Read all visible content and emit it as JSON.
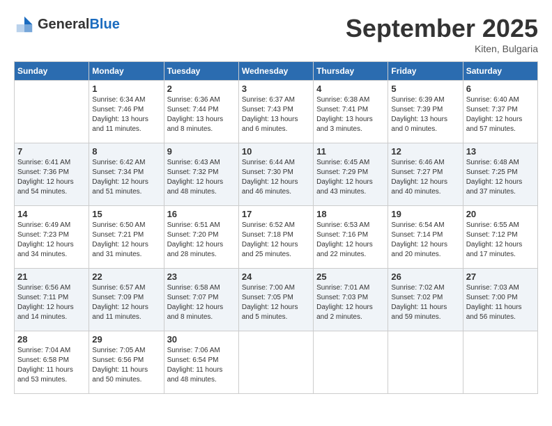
{
  "header": {
    "logo_general": "General",
    "logo_blue": "Blue",
    "month_title": "September 2025",
    "location": "Kiten, Bulgaria"
  },
  "weekdays": [
    "Sunday",
    "Monday",
    "Tuesday",
    "Wednesday",
    "Thursday",
    "Friday",
    "Saturday"
  ],
  "weeks": [
    [
      {
        "day": null
      },
      {
        "day": "1",
        "sunrise": "Sunrise: 6:34 AM",
        "sunset": "Sunset: 7:46 PM",
        "daylight": "Daylight: 13 hours and 11 minutes."
      },
      {
        "day": "2",
        "sunrise": "Sunrise: 6:36 AM",
        "sunset": "Sunset: 7:44 PM",
        "daylight": "Daylight: 13 hours and 8 minutes."
      },
      {
        "day": "3",
        "sunrise": "Sunrise: 6:37 AM",
        "sunset": "Sunset: 7:43 PM",
        "daylight": "Daylight: 13 hours and 6 minutes."
      },
      {
        "day": "4",
        "sunrise": "Sunrise: 6:38 AM",
        "sunset": "Sunset: 7:41 PM",
        "daylight": "Daylight: 13 hours and 3 minutes."
      },
      {
        "day": "5",
        "sunrise": "Sunrise: 6:39 AM",
        "sunset": "Sunset: 7:39 PM",
        "daylight": "Daylight: 13 hours and 0 minutes."
      },
      {
        "day": "6",
        "sunrise": "Sunrise: 6:40 AM",
        "sunset": "Sunset: 7:37 PM",
        "daylight": "Daylight: 12 hours and 57 minutes."
      }
    ],
    [
      {
        "day": "7",
        "sunrise": "Sunrise: 6:41 AM",
        "sunset": "Sunset: 7:36 PM",
        "daylight": "Daylight: 12 hours and 54 minutes."
      },
      {
        "day": "8",
        "sunrise": "Sunrise: 6:42 AM",
        "sunset": "Sunset: 7:34 PM",
        "daylight": "Daylight: 12 hours and 51 minutes."
      },
      {
        "day": "9",
        "sunrise": "Sunrise: 6:43 AM",
        "sunset": "Sunset: 7:32 PM",
        "daylight": "Daylight: 12 hours and 48 minutes."
      },
      {
        "day": "10",
        "sunrise": "Sunrise: 6:44 AM",
        "sunset": "Sunset: 7:30 PM",
        "daylight": "Daylight: 12 hours and 46 minutes."
      },
      {
        "day": "11",
        "sunrise": "Sunrise: 6:45 AM",
        "sunset": "Sunset: 7:29 PM",
        "daylight": "Daylight: 12 hours and 43 minutes."
      },
      {
        "day": "12",
        "sunrise": "Sunrise: 6:46 AM",
        "sunset": "Sunset: 7:27 PM",
        "daylight": "Daylight: 12 hours and 40 minutes."
      },
      {
        "day": "13",
        "sunrise": "Sunrise: 6:48 AM",
        "sunset": "Sunset: 7:25 PM",
        "daylight": "Daylight: 12 hours and 37 minutes."
      }
    ],
    [
      {
        "day": "14",
        "sunrise": "Sunrise: 6:49 AM",
        "sunset": "Sunset: 7:23 PM",
        "daylight": "Daylight: 12 hours and 34 minutes."
      },
      {
        "day": "15",
        "sunrise": "Sunrise: 6:50 AM",
        "sunset": "Sunset: 7:21 PM",
        "daylight": "Daylight: 12 hours and 31 minutes."
      },
      {
        "day": "16",
        "sunrise": "Sunrise: 6:51 AM",
        "sunset": "Sunset: 7:20 PM",
        "daylight": "Daylight: 12 hours and 28 minutes."
      },
      {
        "day": "17",
        "sunrise": "Sunrise: 6:52 AM",
        "sunset": "Sunset: 7:18 PM",
        "daylight": "Daylight: 12 hours and 25 minutes."
      },
      {
        "day": "18",
        "sunrise": "Sunrise: 6:53 AM",
        "sunset": "Sunset: 7:16 PM",
        "daylight": "Daylight: 12 hours and 22 minutes."
      },
      {
        "day": "19",
        "sunrise": "Sunrise: 6:54 AM",
        "sunset": "Sunset: 7:14 PM",
        "daylight": "Daylight: 12 hours and 20 minutes."
      },
      {
        "day": "20",
        "sunrise": "Sunrise: 6:55 AM",
        "sunset": "Sunset: 7:12 PM",
        "daylight": "Daylight: 12 hours and 17 minutes."
      }
    ],
    [
      {
        "day": "21",
        "sunrise": "Sunrise: 6:56 AM",
        "sunset": "Sunset: 7:11 PM",
        "daylight": "Daylight: 12 hours and 14 minutes."
      },
      {
        "day": "22",
        "sunrise": "Sunrise: 6:57 AM",
        "sunset": "Sunset: 7:09 PM",
        "daylight": "Daylight: 12 hours and 11 minutes."
      },
      {
        "day": "23",
        "sunrise": "Sunrise: 6:58 AM",
        "sunset": "Sunset: 7:07 PM",
        "daylight": "Daylight: 12 hours and 8 minutes."
      },
      {
        "day": "24",
        "sunrise": "Sunrise: 7:00 AM",
        "sunset": "Sunset: 7:05 PM",
        "daylight": "Daylight: 12 hours and 5 minutes."
      },
      {
        "day": "25",
        "sunrise": "Sunrise: 7:01 AM",
        "sunset": "Sunset: 7:03 PM",
        "daylight": "Daylight: 12 hours and 2 minutes."
      },
      {
        "day": "26",
        "sunrise": "Sunrise: 7:02 AM",
        "sunset": "Sunset: 7:02 PM",
        "daylight": "Daylight: 11 hours and 59 minutes."
      },
      {
        "day": "27",
        "sunrise": "Sunrise: 7:03 AM",
        "sunset": "Sunset: 7:00 PM",
        "daylight": "Daylight: 11 hours and 56 minutes."
      }
    ],
    [
      {
        "day": "28",
        "sunrise": "Sunrise: 7:04 AM",
        "sunset": "Sunset: 6:58 PM",
        "daylight": "Daylight: 11 hours and 53 minutes."
      },
      {
        "day": "29",
        "sunrise": "Sunrise: 7:05 AM",
        "sunset": "Sunset: 6:56 PM",
        "daylight": "Daylight: 11 hours and 50 minutes."
      },
      {
        "day": "30",
        "sunrise": "Sunrise: 7:06 AM",
        "sunset": "Sunset: 6:54 PM",
        "daylight": "Daylight: 11 hours and 48 minutes."
      },
      {
        "day": null
      },
      {
        "day": null
      },
      {
        "day": null
      },
      {
        "day": null
      }
    ]
  ]
}
